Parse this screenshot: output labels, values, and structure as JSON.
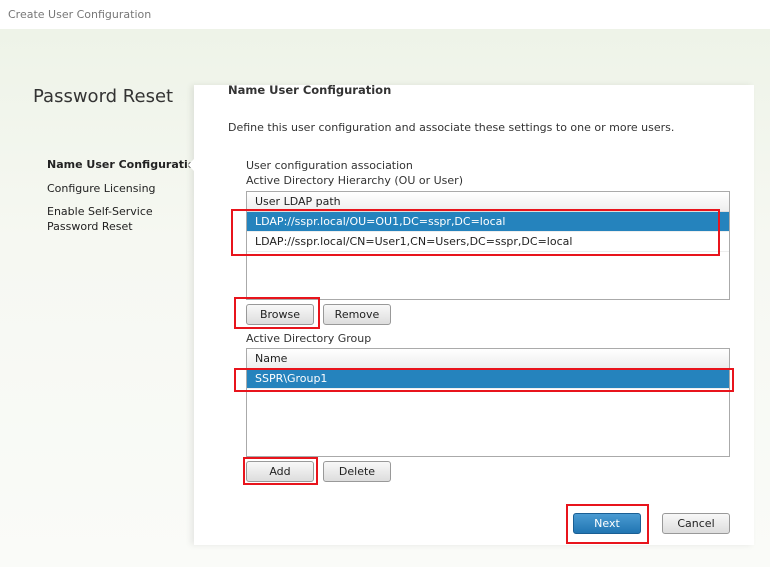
{
  "window": {
    "title": "Create User Configuration"
  },
  "sidebar": {
    "title": "Password Reset",
    "items": [
      {
        "label": "Name User Configuration",
        "active": true
      },
      {
        "label": "Configure Licensing"
      },
      {
        "label": "Enable Self-Service"
      },
      {
        "label": "Password Reset"
      }
    ]
  },
  "main": {
    "heading": "Name User Configuration",
    "description": "Define this user configuration and associate these settings to one or more users.",
    "association_label": "User configuration association",
    "hierarchy_label": "Active Directory Hierarchy (OU or User)",
    "ldap_list": {
      "header": "User LDAP path",
      "rows": [
        "LDAP://sspr.local/OU=OU1,DC=sspr,DC=local",
        "LDAP://sspr.local/CN=User1,CN=Users,DC=sspr,DC=local"
      ]
    },
    "browse_label": "Browse",
    "remove_label": "Remove",
    "group_label": "Active Directory Group",
    "group_list": {
      "header": "Name",
      "rows": [
        "SSPR\\Group1"
      ]
    },
    "add_label": "Add",
    "delete_label": "Delete"
  },
  "footer": {
    "next_label": "Next",
    "cancel_label": "Cancel"
  },
  "colors": {
    "selection": "#2583bd",
    "highlight": "#e8141c"
  }
}
